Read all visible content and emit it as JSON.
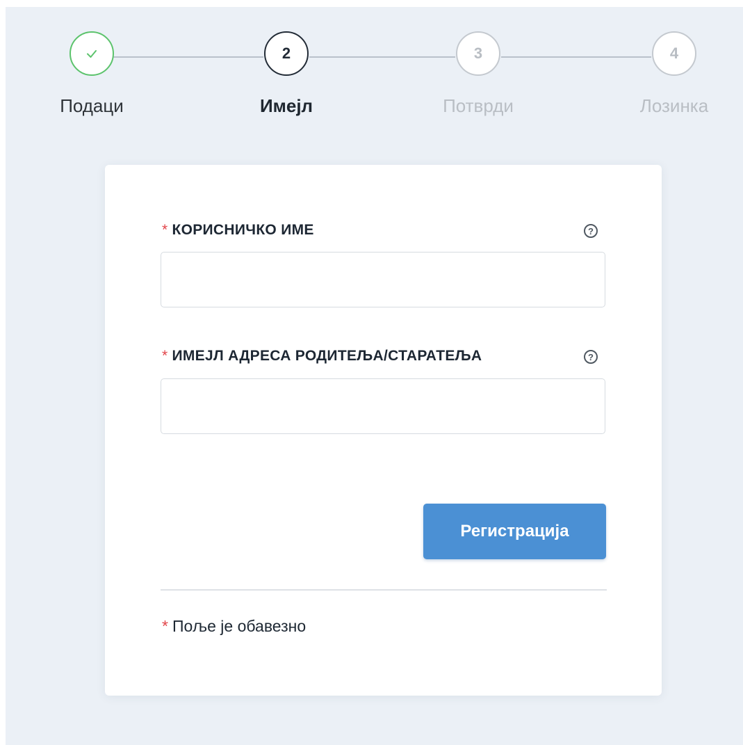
{
  "stepper": {
    "steps": [
      {
        "number": "✓",
        "label": "Подаци",
        "state": "done"
      },
      {
        "number": "2",
        "label": "Имејл",
        "state": "active"
      },
      {
        "number": "3",
        "label": "Потврди",
        "state": "pending"
      },
      {
        "number": "4",
        "label": "Лозинка",
        "state": "pending"
      }
    ]
  },
  "form": {
    "required_mark": "*",
    "help_glyph": "?",
    "username": {
      "label": "КОРИСНИЧКО ИМЕ",
      "value": ""
    },
    "guardian_email": {
      "label": "ИМЕЈЛ АДРЕСА РОДИТЕЉА/СТАРАТЕЉА",
      "value": ""
    },
    "submit_label": "Регистрација",
    "footnote": "Поље је обавезно"
  },
  "colors": {
    "background": "#ebf0f6",
    "step_done": "#5cc36c",
    "step_active": "#222b36",
    "step_pending": "#c4c9cf",
    "required": "#e2454a",
    "primary": "#4b90d4"
  }
}
